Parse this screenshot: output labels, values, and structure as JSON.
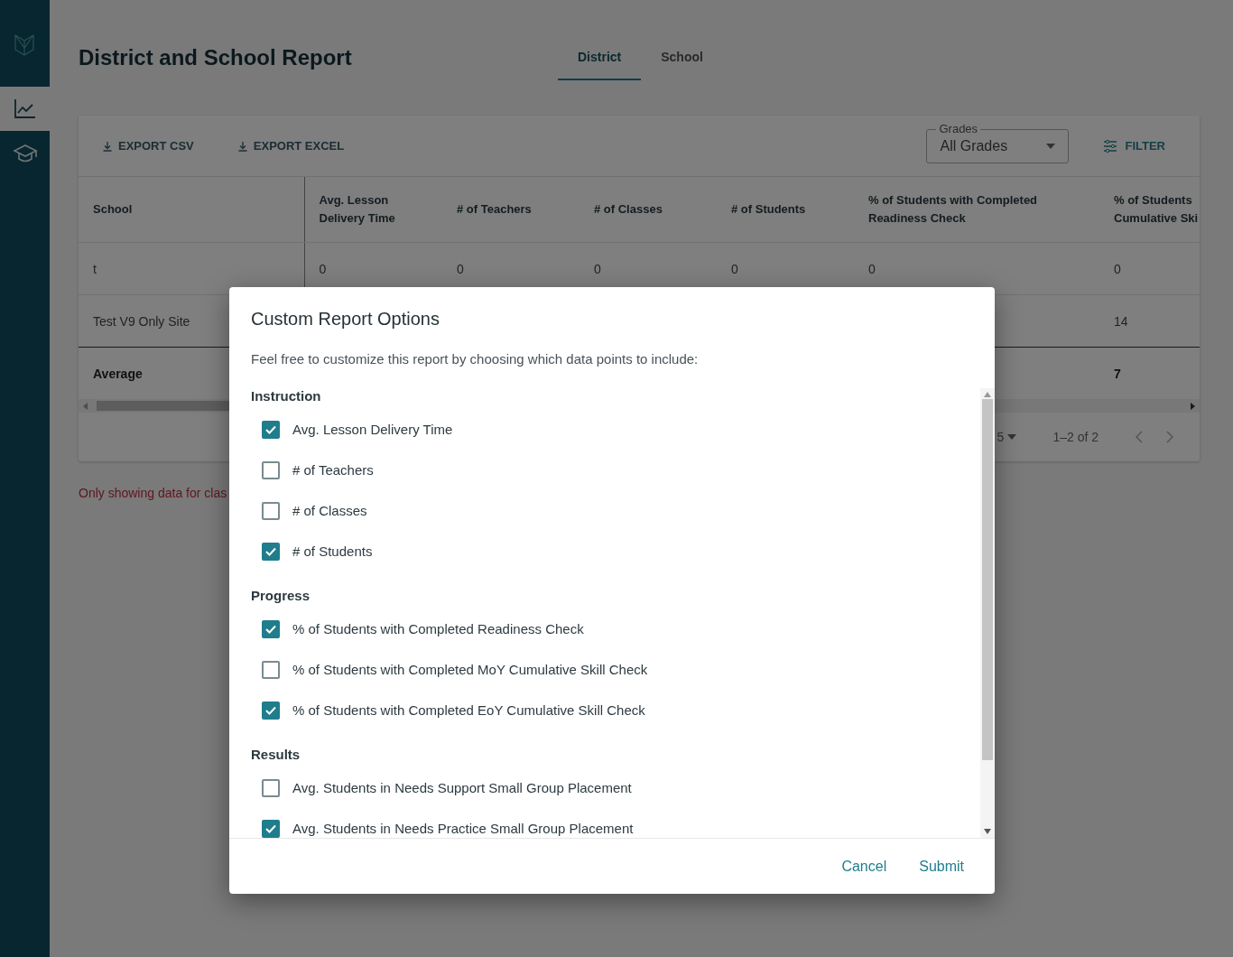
{
  "sidebar": {
    "items": [
      {
        "kind": "logo",
        "selected": false
      },
      {
        "kind": "chart",
        "selected": true
      },
      {
        "kind": "cap",
        "selected": false
      }
    ]
  },
  "header": {
    "title": "District and School Report",
    "tabs": [
      {
        "label": "District",
        "selected": true
      },
      {
        "label": "School",
        "selected": false
      }
    ]
  },
  "toolbar": {
    "exports": [
      "EXPORT CSV",
      "EXPORT EXCEL"
    ],
    "grades": {
      "label": "Grades",
      "value": "All Grades"
    },
    "filter": "FILTER"
  },
  "table": {
    "columns": [
      "School",
      "Avg. Lesson Delivery Time",
      "# of Teachers",
      "# of Classes",
      "# of Students",
      "% of Students with Completed Readiness Check",
      "% of Students Cumulative Ski"
    ],
    "rows": [
      {
        "kind": "data",
        "cells": [
          "t",
          "0",
          "0",
          "0",
          "0",
          "0",
          "0"
        ]
      },
      {
        "kind": "data",
        "cells": [
          "Test V9 Only Site",
          null,
          null,
          null,
          null,
          null,
          "14"
        ]
      },
      {
        "kind": "average",
        "cells": [
          "Average",
          null,
          null,
          null,
          null,
          null,
          "7"
        ]
      }
    ]
  },
  "pagination": {
    "per_page": "5",
    "range": "1–2 of 2"
  },
  "note": "Only showing data for clas",
  "dialog": {
    "title": "Custom Report Options",
    "description": "Feel free to customize this report by choosing which data points to include:",
    "sections": [
      {
        "title": "Instruction",
        "options": [
          {
            "label": "Avg. Lesson Delivery Time",
            "checked": true
          },
          {
            "label": "# of Teachers",
            "checked": false
          },
          {
            "label": "# of Classes",
            "checked": false
          },
          {
            "label": "# of Students",
            "checked": true
          }
        ]
      },
      {
        "title": "Progress",
        "options": [
          {
            "label": "% of Students with Completed Readiness Check",
            "checked": true
          },
          {
            "label": "% of Students with Completed MoY Cumulative Skill Check",
            "checked": false
          },
          {
            "label": "% of Students with Completed EoY Cumulative Skill Check",
            "checked": true
          }
        ]
      },
      {
        "title": "Results",
        "options": [
          {
            "label": "Avg. Students in Needs Support Small Group Placement",
            "checked": false
          },
          {
            "label": "Avg. Students in Needs Practice Small Group Placement",
            "checked": true
          }
        ]
      }
    ],
    "buttons": [
      "Cancel",
      "Submit"
    ]
  }
}
